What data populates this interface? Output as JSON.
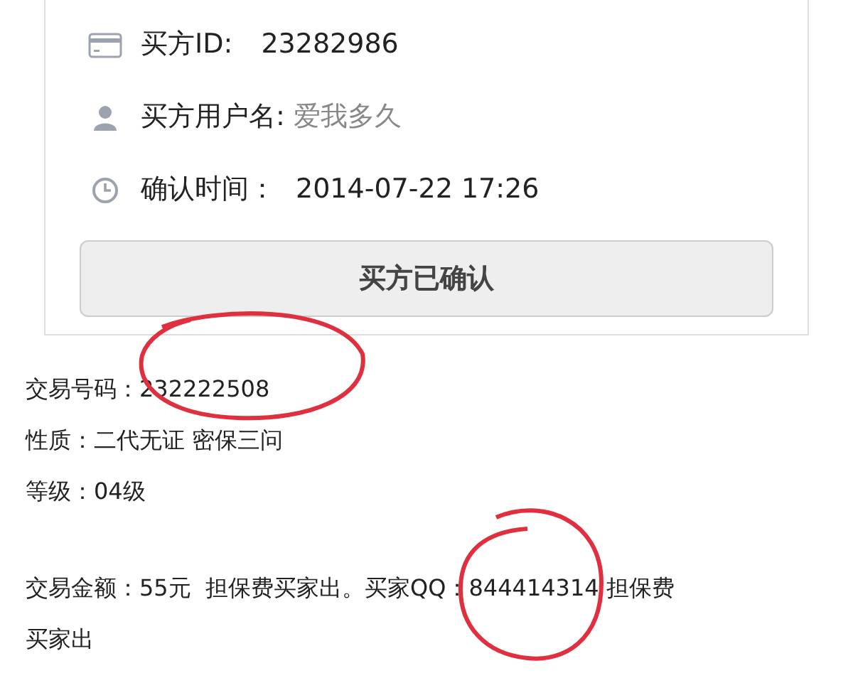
{
  "card": {
    "rows": [
      {
        "kind": "card",
        "label": "买方ID: ",
        "value": "23282986",
        "muted": false
      },
      {
        "kind": "user",
        "label": "买方用户名: ",
        "value": "爱我多久",
        "muted": true
      },
      {
        "kind": "clock",
        "label": "确认时间：",
        "value": "2014-07-22 17:26",
        "muted": false
      }
    ],
    "button": {
      "label": "买方已确认",
      "disabled": true
    }
  },
  "details": [
    "交易号码：232222508",
    "性质：二代无证 密保三问",
    "等级：04级"
  ],
  "note_lines": [
    "交易金额：55元  担保费买家出。买家QQ：844414314 担保费",
    "买家出"
  ]
}
